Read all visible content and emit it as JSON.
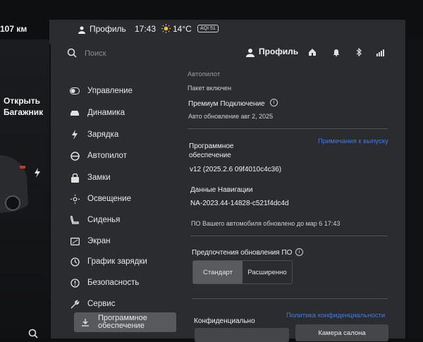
{
  "status_bar": {
    "range": "107 км",
    "profile": "Профиль",
    "time": "17:43",
    "temperature": "14°C",
    "aqi": "AQI 51"
  },
  "car": {
    "trunk_label": "Открыть Багажник"
  },
  "header": {
    "search_placeholder": "Поиск",
    "profile_label": "Профиль",
    "icons": [
      "home-icon",
      "bell-icon",
      "bluetooth-icon",
      "lte-signal-icon"
    ]
  },
  "sidebar": {
    "items": [
      {
        "label": "Управление",
        "icon": "toggle-icon"
      },
      {
        "label": "Динамика",
        "icon": "car-icon"
      },
      {
        "label": "Зарядка",
        "icon": "bolt-icon"
      },
      {
        "label": "Автопилот",
        "icon": "steering-wheel-icon"
      },
      {
        "label": "Замки",
        "icon": "lock-icon"
      },
      {
        "label": "Освещение",
        "icon": "sun-icon"
      },
      {
        "label": "Сиденья",
        "icon": "seat-icon"
      },
      {
        "label": "Экран",
        "icon": "screen-icon"
      },
      {
        "label": "График зарядки",
        "icon": "clock-icon"
      },
      {
        "label": "Безопасность",
        "icon": "shield-icon"
      },
      {
        "label": "Сервис",
        "icon": "wrench-icon"
      },
      {
        "label": "Программное обеспечение",
        "icon": "download-icon",
        "active": true
      }
    ]
  },
  "content": {
    "autopilot_title": "Автопилот",
    "autopilot_status": "Пакет включен",
    "premium_title": "Премиум Подключение",
    "premium_status": "Авто обновление авг 2, 2025",
    "software_title": "Программное обеспечение",
    "release_notes_link": "Примечания к выпуску",
    "software_version": "v12 (2025.2.6 09f4010c4c36)",
    "nav_title": "Данные Навигации",
    "nav_version": "NA-2023.44-14828-c521f4dc4d",
    "update_note": "ПО Вашего автомобиля обновлено до мар 6 17:43",
    "pref_title": "Предпочтения обновления ПО",
    "pref_options": [
      "Стандарт",
      "Расширенно"
    ],
    "pref_selected": "Стандарт",
    "privacy_title": "Конфиденциально",
    "privacy_link": "Политика конфиденциальности",
    "camera_button": "Камера салона"
  },
  "colors": {
    "panel_bg": "#2b2c30",
    "link": "#3e7be8",
    "selected_segment": "#5a5b5f"
  }
}
